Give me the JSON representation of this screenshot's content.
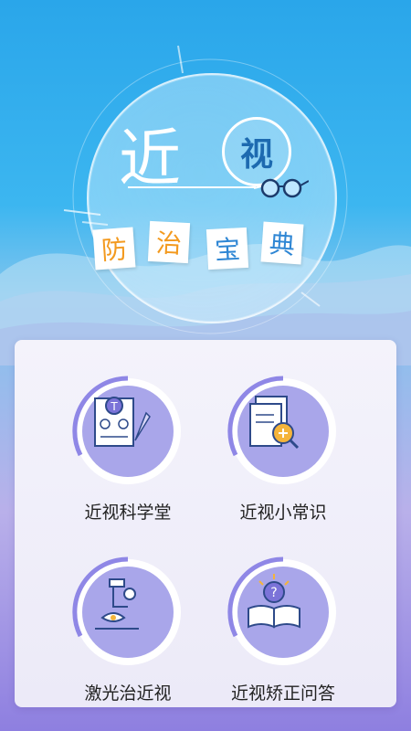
{
  "hero": {
    "title_char1": "近",
    "title_char2": "视",
    "subtitle_tiles": [
      {
        "char": "防",
        "color": "#f39a1f"
      },
      {
        "char": "治",
        "color": "#f39a1f"
      },
      {
        "char": "宝",
        "color": "#2e86d4"
      },
      {
        "char": "典",
        "color": "#2e86d4"
      }
    ]
  },
  "menu": {
    "items": [
      {
        "label": "近视科学堂",
        "icon": "eye-chart-document-icon"
      },
      {
        "label": "近视小常识",
        "icon": "document-magnifier-icon"
      },
      {
        "label": "激光治近视",
        "icon": "laser-eye-microscope-icon"
      },
      {
        "label": "近视矫正问答",
        "icon": "book-question-icon"
      }
    ]
  },
  "colors": {
    "accent_purple": "#a9a6ea",
    "ring_purple": "#8f87e6",
    "icon_blue": "#2e86d4",
    "icon_orange": "#f5b43a"
  }
}
